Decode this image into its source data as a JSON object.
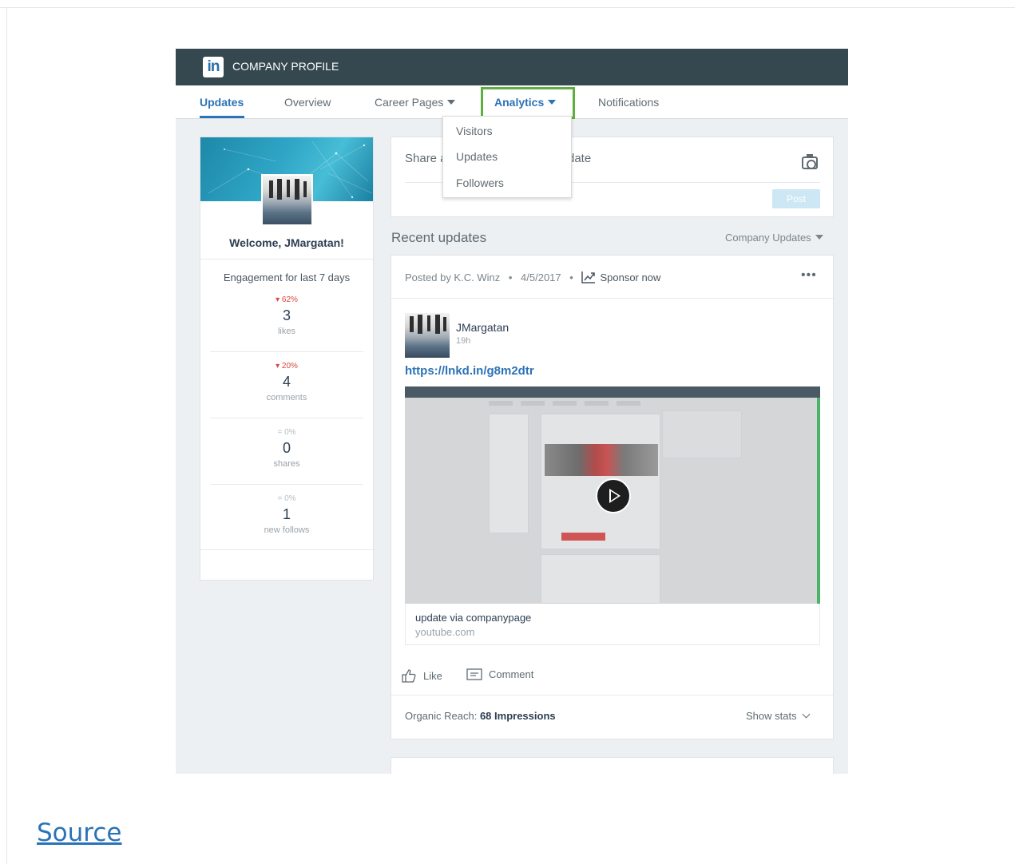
{
  "header": {
    "logo_text": "in",
    "title": "COMPANY PROFILE"
  },
  "tabs": {
    "updates": "Updates",
    "overview": "Overview",
    "career_pages": "Career Pages",
    "analytics": "Analytics",
    "notifications": "Notifications"
  },
  "analytics_menu": {
    "items": [
      "Visitors",
      "Updates",
      "Followers"
    ]
  },
  "sidebar": {
    "welcome": "Welcome, JMargatan!",
    "engagement_title": "Engagement for last 7 days",
    "stats": [
      {
        "change": "▾ 62%",
        "value": "3",
        "label": "likes"
      },
      {
        "change": "▾ 20%",
        "value": "4",
        "label": "comments"
      },
      {
        "change": "= 0%",
        "value": "0",
        "label": "shares"
      },
      {
        "change": "= 0%",
        "value": "1",
        "label": "new follows"
      }
    ]
  },
  "share_box": {
    "placeholder_start": "Share a",
    "placeholder_end": "date",
    "post_label": "Post"
  },
  "feed": {
    "recent_title": "Recent updates",
    "filter_label": "Company Updates"
  },
  "post": {
    "posted_by": "Posted by K.C. Winz",
    "date": "4/5/2017",
    "sponsor": "Sponsor now",
    "more": "•••",
    "author": "JMargatan",
    "time": "19h",
    "link": "https://lnkd.in/g8m2dtr",
    "video_title": "update via companypage",
    "video_source": "youtube.com",
    "like": "Like",
    "comment": "Comment",
    "reach_label": "Organic Reach:",
    "reach_value": "68 Impressions",
    "show_stats": "Show stats"
  },
  "footer": {
    "source_link": "Source"
  },
  "colors": {
    "topbar": "#35474f",
    "accent": "#2a73b6",
    "highlight_box": "#5fae3f",
    "negative": "#d9463e"
  }
}
